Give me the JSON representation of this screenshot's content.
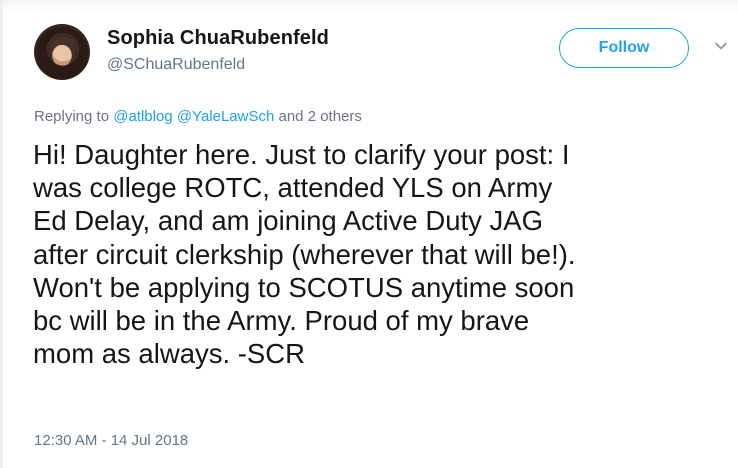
{
  "tweet": {
    "author": {
      "name": "Sophia ChuaRubenfeld",
      "handle": "@SChuaRubenfeld"
    },
    "follow_label": "Follow",
    "replying_to": {
      "prefix": "Replying to",
      "mentions": [
        "@atlblog",
        "@YaleLawSch"
      ],
      "suffix": "and 2 others"
    },
    "text_lines": [
      "Hi! Daughter here. Just to clarify your post: I",
      "was college ROTC, attended YLS on Army",
      "Ed Delay, and am joining Active Duty JAG",
      "after circuit clerkship (wherever that will be!).",
      "Won't be applying to SCOTUS anytime soon",
      "bc will be in the Army. Proud of my brave",
      "mom as always. -SCR"
    ],
    "timestamp": "12:30 AM - 14 Jul 2018",
    "icons": {
      "avatar": "profile-photo",
      "menu": "chevron-down-icon"
    },
    "colors": {
      "accent": "#1da1f2",
      "text": "#14171a",
      "secondary_text": "#657786",
      "chevron": "#8899a6"
    }
  }
}
